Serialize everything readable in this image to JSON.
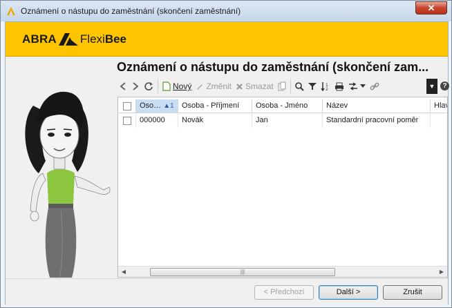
{
  "window": {
    "title": "Oznámení o nástupu do zaměstnání (skončení zaměstnání)",
    "close_glyph": "✕"
  },
  "banner": {
    "logo_abra": "ABRA",
    "logo_flexi": "Flexi",
    "logo_bee": "Bee",
    "brand_color": "#ffc400"
  },
  "page": {
    "title": "Oznámení o nástupu do zaměstnání (skončení zam..."
  },
  "toolbar": {
    "new_label": "Nový",
    "edit_label": "Změnit",
    "delete_label": "Smazat"
  },
  "grid": {
    "columns": [
      "Oso…",
      "Osoba - Příjmení",
      "Osoba - Jméno",
      "Název",
      "Hlav"
    ],
    "sort_indicator": "▲1",
    "rows": [
      [
        "000000",
        "Novák",
        "Jan",
        "Standardní pracovní poměr",
        ""
      ]
    ]
  },
  "footer": {
    "back_label": "< Předchozí",
    "next_label": "Další >",
    "cancel_label": "Zrušit"
  }
}
